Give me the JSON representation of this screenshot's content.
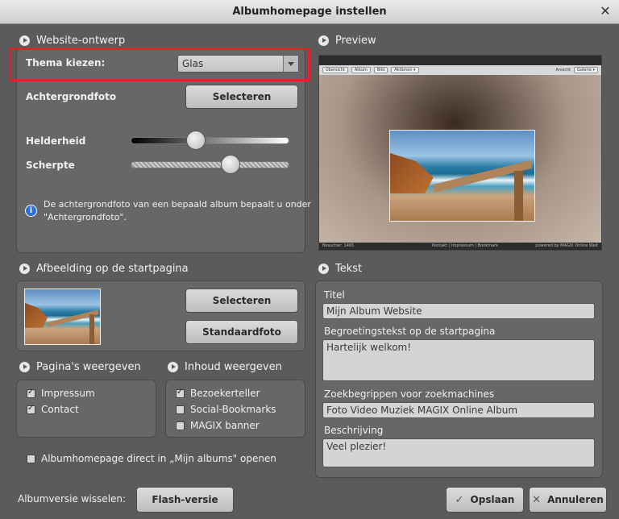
{
  "window": {
    "title": "Albumhomepage instellen",
    "close_glyph": "✕"
  },
  "sections": {
    "design": "Website-ontwerp",
    "preview": "Preview",
    "start_image": "Afbeelding op de startpagina",
    "text": "Tekst",
    "pages": "Pagina's weergeven",
    "content": "Inhoud weergeven"
  },
  "design": {
    "theme_label": "Thema kiezen:",
    "theme_value": "Glas",
    "background_label": "Achtergrondfoto",
    "select_button": "Selecteren",
    "brightness_label": "Helderheid",
    "brightness_value": 0.41,
    "sharpness_label": "Scherpte",
    "sharpness_value": 0.63,
    "info_line1": "De achtergrondfoto van een bepaald album bepaalt u onder",
    "info_line2": "\"Achtergrondfoto\"."
  },
  "preview": {
    "nav": [
      "Übersicht",
      "Album",
      "Bild",
      "Aktionen ▾"
    ],
    "view_label": "Ansicht",
    "view_value": "Galerie ▾",
    "footer_left": "Besucher: 1465",
    "footer_mid": "Kontakt  |  Impressum  |  Bookmark",
    "footer_right": "powered by MAGIX Online Welt"
  },
  "start_image": {
    "select_button": "Selecteren",
    "default_button": "Standaardfoto"
  },
  "pages": {
    "items": [
      {
        "label": "Impressum",
        "checked": true
      },
      {
        "label": "Contact",
        "checked": true
      }
    ]
  },
  "content": {
    "items": [
      {
        "label": "Bezoekerteller",
        "checked": true
      },
      {
        "label": "Social-Bookmarks",
        "checked": false
      },
      {
        "label": "MAGIX banner",
        "checked": false
      }
    ]
  },
  "open_direct": {
    "label": "Albumhomepage direct in „Mijn albums\" openen",
    "checked": false
  },
  "text": {
    "title_label": "Titel",
    "title_value": "Mijn Album Website",
    "greeting_label": "Begroetingstekst op de startpagina",
    "greeting_value": "Hartelijk welkom!",
    "keywords_label": "Zoekbegrippen voor zoekmachines",
    "keywords_value": "Foto Video Muziek MAGIX Online Album",
    "description_label": "Beschrijving",
    "description_value": "Veel plezier!"
  },
  "footer": {
    "version_label": "Albumversie wisselen:",
    "flash_button": "Flash-versie",
    "save_button": "Opslaan",
    "cancel_button": "Annuleren"
  },
  "colors": {
    "highlight": "#e0202a",
    "info": "#2c6fd0"
  },
  "icons": [
    "close-icon",
    "play-icon",
    "dropdown-arrow-icon",
    "info-icon",
    "check-icon",
    "cancel-icon"
  ]
}
